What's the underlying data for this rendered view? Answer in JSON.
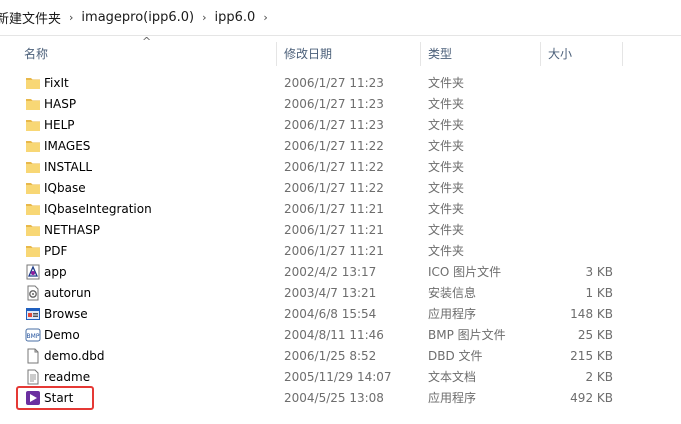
{
  "breadcrumb": [
    "新建文件夹",
    "imagepro(ipp6.0)",
    "ipp6.0"
  ],
  "breadcrumb_separator": "›",
  "columns": {
    "name": "名称",
    "date": "修改日期",
    "type": "类型",
    "size": "大小"
  },
  "sort_indicator": "^",
  "files": [
    {
      "name": "FixIt",
      "date": "2006/1/27 11:23",
      "type": "文件夹",
      "size": "",
      "icon": "folder-icon"
    },
    {
      "name": "HASP",
      "date": "2006/1/27 11:23",
      "type": "文件夹",
      "size": "",
      "icon": "folder-icon"
    },
    {
      "name": "HELP",
      "date": "2006/1/27 11:23",
      "type": "文件夹",
      "size": "",
      "icon": "folder-icon"
    },
    {
      "name": "IMAGES",
      "date": "2006/1/27 11:22",
      "type": "文件夹",
      "size": "",
      "icon": "folder-icon"
    },
    {
      "name": "INSTALL",
      "date": "2006/1/27 11:22",
      "type": "文件夹",
      "size": "",
      "icon": "folder-icon"
    },
    {
      "name": "IQbase",
      "date": "2006/1/27 11:22",
      "type": "文件夹",
      "size": "",
      "icon": "folder-icon"
    },
    {
      "name": "IQbaseIntegration",
      "date": "2006/1/27 11:21",
      "type": "文件夹",
      "size": "",
      "icon": "folder-icon"
    },
    {
      "name": "NETHASP",
      "date": "2006/1/27 11:21",
      "type": "文件夹",
      "size": "",
      "icon": "folder-icon"
    },
    {
      "name": "PDF",
      "date": "2006/1/27 11:21",
      "type": "文件夹",
      "size": "",
      "icon": "folder-icon"
    },
    {
      "name": "app",
      "date": "2002/4/2 13:17",
      "type": "ICO 图片文件",
      "size": "3 KB",
      "icon": "ico-file-icon"
    },
    {
      "name": "autorun",
      "date": "2003/4/7 13:21",
      "type": "安装信息",
      "size": "1 KB",
      "icon": "setup-info-icon"
    },
    {
      "name": "Browse",
      "date": "2004/6/8 15:54",
      "type": "应用程序",
      "size": "148 KB",
      "icon": "browse-app-icon"
    },
    {
      "name": "Demo",
      "date": "2004/8/11 11:46",
      "type": "BMP 图片文件",
      "size": "25 KB",
      "icon": "bmp-file-icon"
    },
    {
      "name": "demo.dbd",
      "date": "2006/1/25 8:52",
      "type": "DBD 文件",
      "size": "215 KB",
      "icon": "generic-file-icon"
    },
    {
      "name": "readme",
      "date": "2005/11/29 14:07",
      "type": "文本文档",
      "size": "2 KB",
      "icon": "text-file-icon"
    },
    {
      "name": "Start",
      "date": "2004/5/25 13:08",
      "type": "应用程序",
      "size": "492 KB",
      "icon": "start-app-icon",
      "highlighted": true
    }
  ],
  "colors": {
    "highlight_box": "#e53935",
    "folder": "#f8d775",
    "header_text": "#4c607a"
  }
}
